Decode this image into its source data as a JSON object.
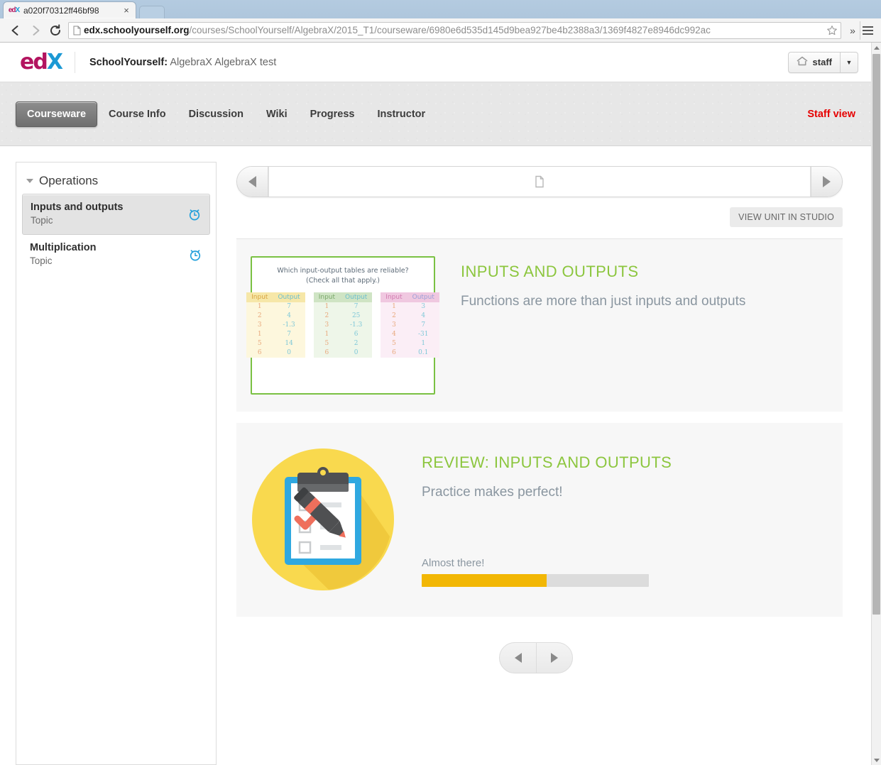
{
  "browser": {
    "tab": {
      "title": "a020f70312ff46bf98",
      "favicon": "edx-favicon",
      "close_label": "×"
    },
    "toolbar": {
      "back_icon": "back-arrow-icon",
      "forward_icon": "forward-arrow-icon",
      "reload_icon": "reload-icon",
      "page_icon": "page-icon",
      "url_domain": "edx.schoolyourself.org",
      "url_path": "/courses/SchoolYourself/AlgebraX/2015_T1/courseware/6980e6d535d145d9bea927be4b2388a3/1369f4827e8946dc992ac",
      "bookmark_icon": "star-icon",
      "overflow_label": "»",
      "menu_icon": "hamburger-menu-icon"
    }
  },
  "header": {
    "logo_ed": "ed",
    "logo_x": "X",
    "org": "SchoolYourself:",
    "course": "AlgebraX AlgebraX test",
    "account": {
      "home_icon": "home-icon",
      "username": "staff",
      "caret": "▼"
    }
  },
  "course_nav": {
    "tabs": [
      {
        "label": "Courseware",
        "active": true
      },
      {
        "label": "Course Info",
        "active": false
      },
      {
        "label": "Discussion",
        "active": false
      },
      {
        "label": "Wiki",
        "active": false
      },
      {
        "label": "Progress",
        "active": false
      },
      {
        "label": "Instructor",
        "active": false
      }
    ],
    "staff_view": "Staff view",
    "staff_view_color": "#e60000"
  },
  "sidebar": {
    "chapter": "Operations",
    "collapse_icon": "chevron-down-icon",
    "units": [
      {
        "name": "Inputs and outputs",
        "type": "Topic",
        "icon": "timed-exam-clock-icon",
        "active": true
      },
      {
        "name": "Multiplication",
        "type": "Topic",
        "icon": "timed-exam-clock-icon",
        "active": false
      }
    ],
    "icon_color": "#23a0db"
  },
  "sequence": {
    "prev_icon": "previous-arrow-icon",
    "next_icon": "next-arrow-icon",
    "unit_icon": "document-icon"
  },
  "studio": {
    "button_label": "VIEW UNIT IN STUDIO"
  },
  "units": [
    {
      "title": "INPUTS AND OUTPUTS",
      "subtitle": "Functions are more than just inputs and outputs",
      "title_color": "#8cc63e",
      "thumbnail": "input-output-tables-thumbnail",
      "thumbnail_content": {
        "question_line1": "Which input-output tables are reliable?",
        "question_line2": "(Check all that apply.)",
        "tables": [
          {
            "theme": "yellow",
            "headers": [
              "Input",
              "Output"
            ],
            "rows": [
              [
                "1",
                "7"
              ],
              [
                "2",
                "4"
              ],
              [
                "3",
                "-1.3"
              ],
              [
                "1",
                "7"
              ],
              [
                "5",
                "14"
              ],
              [
                "6",
                "0"
              ]
            ]
          },
          {
            "theme": "green",
            "headers": [
              "Input",
              "Output"
            ],
            "rows": [
              [
                "1",
                "7"
              ],
              [
                "2",
                "25"
              ],
              [
                "3",
                "-1.3"
              ],
              [
                "1",
                "6"
              ],
              [
                "5",
                "2"
              ],
              [
                "6",
                "0"
              ]
            ]
          },
          {
            "theme": "pink",
            "headers": [
              "Input",
              "Output"
            ],
            "rows": [
              [
                "1",
                "3"
              ],
              [
                "2",
                "4"
              ],
              [
                "3",
                "7"
              ],
              [
                "4",
                "-31"
              ],
              [
                "5",
                "1"
              ],
              [
                "6",
                "0.1"
              ]
            ]
          }
        ]
      }
    },
    {
      "title": "REVIEW: INPUTS AND OUTPUTS",
      "subtitle": "Practice makes perfect!",
      "title_color": "#8cc63e",
      "thumbnail": "clipboard-checklist-thumbnail",
      "progress": {
        "label": "Almost there!",
        "percent": 55,
        "fill_color": "#f2b705",
        "track_color": "#dcdcdc"
      }
    }
  ],
  "bottom_nav": {
    "prev_icon": "previous-unit-arrow-icon",
    "next_icon": "next-unit-arrow-icon"
  },
  "scrollbar": {
    "up_icon": "scroll-up-arrow-icon",
    "down_icon": "scroll-down-arrow-icon"
  }
}
